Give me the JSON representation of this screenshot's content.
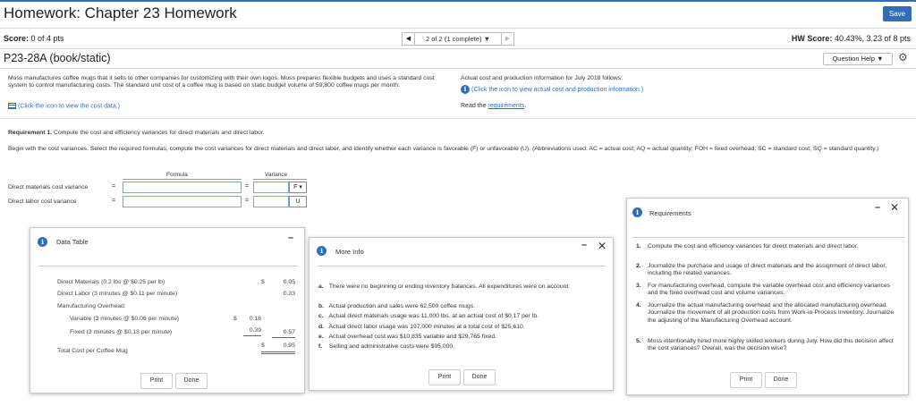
{
  "header": {
    "title": "Homework: Chapter 23 Homework",
    "save_label": "Save",
    "score_label": "Score:",
    "score_value": "0 of 4 pts",
    "nav_status": "2 of 2 (1 complete) ▼",
    "hw_score_label": "HW Score:",
    "hw_score_value": "40.43%, 3.23 of 8 pts"
  },
  "problem": {
    "title": "P23-28A (book/static)",
    "question_help": "Question Help ▼",
    "description": "Moss manufactures coffee mugs that it sells to other companies for customizing with their own logos. Moss prepares flexible budgets and uses a standard cost system to control manufacturing costs. The standard unit cost of a coffee mug is based on static budget volume of 59,800 coffee mugs per month:",
    "cost_data_link": "(Click the icon to view the cost data.)",
    "actual_text": "Actual cost and production information for July 2018 follows:",
    "actual_link": "(Click the icon to view actual cost and production information.)",
    "read_prefix": "Read the ",
    "read_link": "requirements",
    "read_suffix": "."
  },
  "requirement1": {
    "label": "Requirement 1.",
    "text": "Compute the cost and efficiency variances for direct materials and direct labor.",
    "instructions": "Begin with the cost variances. Select the required formulas, compute the cost variances for direct materials and direct labor, and identify whether each variance is favorable (F) or unfavorable (U). (Abbreviations used: AC = actual cost; AQ = actual quantity; FOH = fixed overhead; SC = standard cost; SQ = standard quantity.)",
    "col_formula": "Formula",
    "col_variance": "Variance",
    "rows": [
      {
        "label": "Direct materials cost variance",
        "fu": "F ▾"
      },
      {
        "label": "Direct labor cost variance",
        "fu": "U"
      }
    ]
  },
  "data_table": {
    "title": "Data Table",
    "rows": [
      {
        "label": "Direct Materials (0.2 lbs @ $0.25 per lb)",
        "inner": "",
        "outer": "0.05",
        "dollar_outer": "$"
      },
      {
        "label": "Direct Labor (3 minutes @ $0.11 per minute)",
        "inner": "",
        "outer": "0.33",
        "dollar_outer": ""
      },
      {
        "label": "Manufacturing Overhead:",
        "inner": "",
        "outer": "",
        "dollar_outer": ""
      },
      {
        "label": "Variable (3 minutes @ $0.06 per minute)",
        "inner": "0.18",
        "outer": "",
        "dollar_inner": "$"
      },
      {
        "label": "Fixed (3 minutes @ $0.13 per minute)",
        "inner": "0.39",
        "outer": "0.57",
        "dollar_outer": ""
      },
      {
        "label": "Total Cost per Coffee Mug",
        "inner": "",
        "outer": "0.95",
        "dollar_outer": "$"
      }
    ],
    "print": "Print",
    "done": "Done"
  },
  "more_info": {
    "title": "More Info",
    "items": [
      {
        "letter": "a.",
        "text": "There were no beginning or ending inventory balances. All expenditures were on account."
      },
      {
        "letter": "b.",
        "text": "Actual production and sales were 62,500 coffee mugs."
      },
      {
        "letter": "c.",
        "text": "Actual direct materials usage was 11,000 lbs. at an actual cost of $0.17 per lb."
      },
      {
        "letter": "d.",
        "text": "Actual direct labor usage was 197,000 minutes at a total cost of $25,610."
      },
      {
        "letter": "e.",
        "text": "Actual overhead cost was $10,835 variable and $29,765 fixed."
      },
      {
        "letter": "f.",
        "text": "Selling and administrative costs were $95,000."
      }
    ],
    "print": "Print",
    "done": "Done"
  },
  "requirements": {
    "title": "Requirements",
    "items": [
      {
        "num": "1.",
        "text": "Compute the cost and efficiency variances for direct materials and direct labor."
      },
      {
        "num": "2.",
        "text": "Journalize the purchase and usage of direct materials and the assignment of direct labor, including the related variances."
      },
      {
        "num": "3.",
        "text": "For manufacturing overhead, compute the variable overhead cost and efficiency variances and the fixed overhead cost and volume variances."
      },
      {
        "num": "4.",
        "text": "Journalize the actual manufacturing overhead and the allocated manufacturing overhead. Journalize the movement of all production costs from Work-in-Process Inventory. Journalize the adjusting of the Manufacturing Overhead account."
      },
      {
        "num": "5.",
        "text": "Moss intentionally hired more highly skilled workers during July. How did this decision affect the cost variances? Overall, was the decision wise?"
      }
    ],
    "print": "Print",
    "done": "Done"
  },
  "icons": {
    "info": "i",
    "gear": "⚙",
    "prev": "◀",
    "next": "▶",
    "minimize": "–",
    "close": "✕"
  },
  "colors": {
    "accent": "#2e6fb7"
  }
}
